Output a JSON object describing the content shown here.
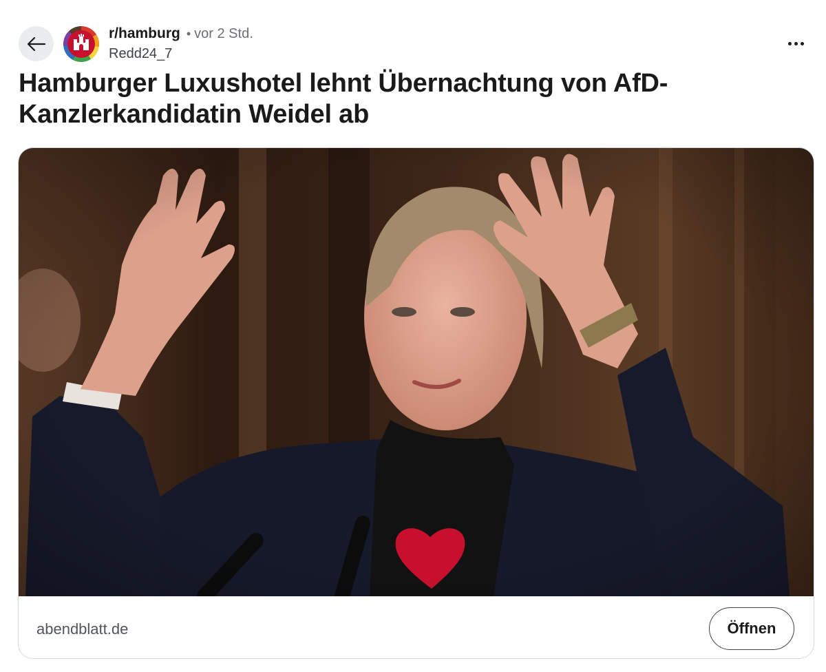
{
  "header": {
    "back_icon": "arrow-left-icon",
    "subreddit": "r/hamburg",
    "separator": "•",
    "time": "vor 2 Std.",
    "author": "Redd24_7",
    "more_icon": "more-horizontal-icon"
  },
  "post": {
    "title": "Hamburger Luxushotel lehnt Übernachtung von AfD-Kanzlerkandidatin Weidel ab"
  },
  "link_card": {
    "domain": "abendblatt.de",
    "open_label": "Öffnen"
  },
  "colors": {
    "accent_red": "#c8102e",
    "text_primary": "#1a1a1b",
    "text_secondary": "#6b7075",
    "button_bg": "#eaedef"
  }
}
